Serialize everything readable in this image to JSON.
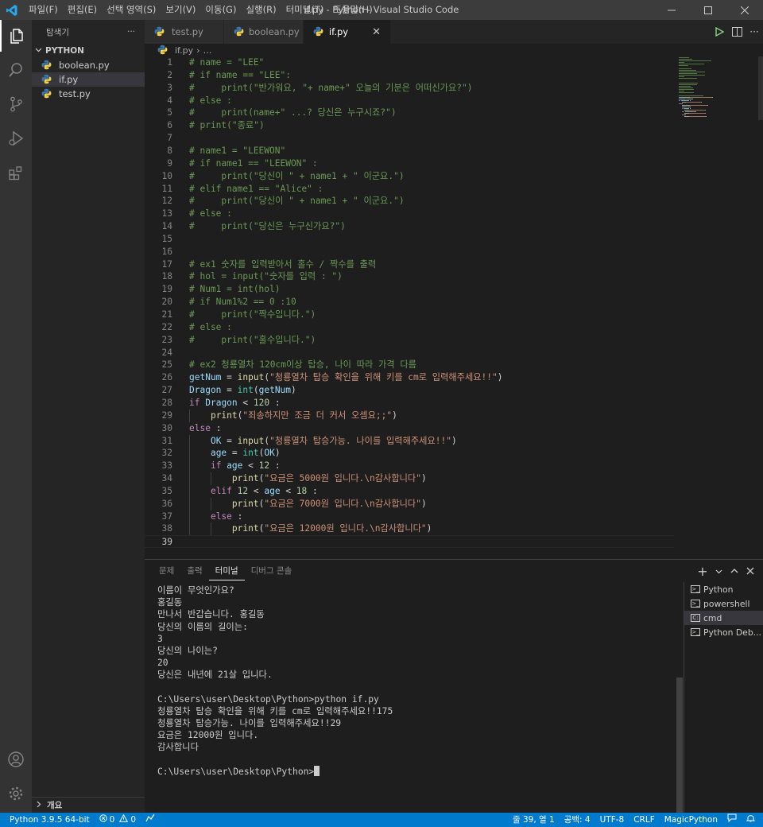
{
  "titlebar": {
    "menus": [
      "파일(F)",
      "편집(E)",
      "선택 영역(S)",
      "보기(V)",
      "이동(G)",
      "실행(R)",
      "터미널(T)",
      "도움말(H)"
    ],
    "window_title": "if.py - Python - Visual Studio Code"
  },
  "sidebar": {
    "title": "탐색기",
    "more": "···",
    "folder": "PYTHON",
    "files": [
      "boolean.py",
      "if.py",
      "test.py"
    ],
    "selected_file": "if.py",
    "outline": "개요"
  },
  "tabs": [
    {
      "label": "test.py",
      "active": false
    },
    {
      "label": "boolean.py",
      "active": false
    },
    {
      "label": "if.py",
      "active": true
    }
  ],
  "breadcrumb": {
    "file": "if.py",
    "rest": "…"
  },
  "editor": {
    "current_line": 39,
    "lines": [
      {
        "n": 1,
        "tokens": [
          [
            "cm",
            "# name = \"LEE\""
          ]
        ]
      },
      {
        "n": 2,
        "tokens": [
          [
            "cm",
            "# if name == \"LEE\":"
          ]
        ]
      },
      {
        "n": 3,
        "tokens": [
          [
            "cm",
            "#     print(\"반가워요, \"+ name+\" 오늘의 기분은 어떠신가요?\")"
          ]
        ]
      },
      {
        "n": 4,
        "tokens": [
          [
            "cm",
            "# else :"
          ]
        ]
      },
      {
        "n": 5,
        "tokens": [
          [
            "cm",
            "#     print(name+\" ...? 당신은 누구시죠?\")"
          ]
        ]
      },
      {
        "n": 6,
        "tokens": [
          [
            "cm",
            "# print(\"종료\")"
          ]
        ]
      },
      {
        "n": 7,
        "tokens": []
      },
      {
        "n": 8,
        "tokens": [
          [
            "cm",
            "# name1 = \"LEEWON\""
          ]
        ]
      },
      {
        "n": 9,
        "tokens": [
          [
            "cm",
            "# if name1 == \"LEEWON\" :"
          ]
        ]
      },
      {
        "n": 10,
        "tokens": [
          [
            "cm",
            "#     print(\"당신이 \" + name1 + \" 이군요.\")"
          ]
        ]
      },
      {
        "n": 11,
        "tokens": [
          [
            "cm",
            "# elif name1 == \"Alice\" :"
          ]
        ]
      },
      {
        "n": 12,
        "tokens": [
          [
            "cm",
            "#     print(\"당신이 \" + name1 + \" 이군요.\")"
          ]
        ]
      },
      {
        "n": 13,
        "tokens": [
          [
            "cm",
            "# else :"
          ]
        ]
      },
      {
        "n": 14,
        "tokens": [
          [
            "cm",
            "#     print(\"당신은 누구신가요?\")"
          ]
        ]
      },
      {
        "n": 15,
        "tokens": []
      },
      {
        "n": 16,
        "tokens": []
      },
      {
        "n": 17,
        "tokens": [
          [
            "cm",
            "# ex1 숫자를 입력받아서 홀수 / 짝수를 출력"
          ]
        ]
      },
      {
        "n": 18,
        "tokens": [
          [
            "cm",
            "# hol = input(\"숫자를 입력 : \")"
          ]
        ]
      },
      {
        "n": 19,
        "tokens": [
          [
            "cm",
            "# Num1 = int(hol)"
          ]
        ]
      },
      {
        "n": 20,
        "tokens": [
          [
            "cm",
            "# if Num1%2 == 0 :10"
          ]
        ]
      },
      {
        "n": 21,
        "tokens": [
          [
            "cm",
            "#     print(\"짝수입니다.\")"
          ]
        ]
      },
      {
        "n": 22,
        "tokens": [
          [
            "cm",
            "# else :"
          ]
        ]
      },
      {
        "n": 23,
        "tokens": [
          [
            "cm",
            "#     print(\"홀수입니다.\")"
          ]
        ]
      },
      {
        "n": 24,
        "tokens": []
      },
      {
        "n": 25,
        "tokens": [
          [
            "cm",
            "# ex2 청룡열차 120cm이상 탑승, 나이 따라 가격 다름"
          ]
        ]
      },
      {
        "n": 26,
        "tokens": [
          [
            "vr",
            "getNum"
          ],
          [
            "op",
            " = "
          ],
          [
            "fn",
            "input"
          ],
          [
            "op",
            "("
          ],
          [
            "st",
            "\"청룡열차 탑승 확인을 위해 키를 cm로 입력해주세요!!\""
          ],
          [
            "op",
            ")"
          ]
        ]
      },
      {
        "n": 27,
        "tokens": [
          [
            "vr",
            "Dragon"
          ],
          [
            "op",
            " = "
          ],
          [
            "bi",
            "int"
          ],
          [
            "op",
            "("
          ],
          [
            "vr",
            "getNum"
          ],
          [
            "op",
            ")"
          ]
        ]
      },
      {
        "n": 28,
        "tokens": [
          [
            "kw",
            "if"
          ],
          [
            "op",
            " "
          ],
          [
            "vr",
            "Dragon"
          ],
          [
            "op",
            " < "
          ],
          [
            "nm",
            "120"
          ],
          [
            "op",
            " :"
          ]
        ]
      },
      {
        "n": 29,
        "tokens": [
          [
            "op",
            "    "
          ],
          [
            "fn",
            "print"
          ],
          [
            "op",
            "("
          ],
          [
            "st",
            "\"죄송하지만 조금 더 커서 오셈요;;\""
          ],
          [
            "op",
            ")"
          ]
        ]
      },
      {
        "n": 30,
        "tokens": [
          [
            "kw",
            "else"
          ],
          [
            "op",
            " :"
          ]
        ]
      },
      {
        "n": 31,
        "tokens": [
          [
            "op",
            "    "
          ],
          [
            "vr",
            "OK"
          ],
          [
            "op",
            " = "
          ],
          [
            "fn",
            "input"
          ],
          [
            "op",
            "("
          ],
          [
            "st",
            "\"청룡열차 탑승가능. 나이를 입력해주세요!!\""
          ],
          [
            "op",
            ")"
          ]
        ]
      },
      {
        "n": 32,
        "tokens": [
          [
            "op",
            "    "
          ],
          [
            "vr",
            "age"
          ],
          [
            "op",
            " = "
          ],
          [
            "bi",
            "int"
          ],
          [
            "op",
            "("
          ],
          [
            "vr",
            "OK"
          ],
          [
            "op",
            ")"
          ]
        ]
      },
      {
        "n": 33,
        "tokens": [
          [
            "op",
            "    "
          ],
          [
            "kw",
            "if"
          ],
          [
            "op",
            " "
          ],
          [
            "vr",
            "age"
          ],
          [
            "op",
            " < "
          ],
          [
            "nm",
            "12"
          ],
          [
            "op",
            " :"
          ]
        ]
      },
      {
        "n": 34,
        "tokens": [
          [
            "op",
            "        "
          ],
          [
            "fn",
            "print"
          ],
          [
            "op",
            "("
          ],
          [
            "st",
            "\"요금은 5000원 입니다.\\n감사합니다\""
          ],
          [
            "op",
            ")"
          ]
        ]
      },
      {
        "n": 35,
        "tokens": [
          [
            "op",
            "    "
          ],
          [
            "kw",
            "elif"
          ],
          [
            "op",
            " "
          ],
          [
            "nm",
            "12"
          ],
          [
            "op",
            " < "
          ],
          [
            "vr",
            "age"
          ],
          [
            "op",
            " < "
          ],
          [
            "nm",
            "18"
          ],
          [
            "op",
            " :"
          ]
        ]
      },
      {
        "n": 36,
        "tokens": [
          [
            "op",
            "        "
          ],
          [
            "fn",
            "print"
          ],
          [
            "op",
            "("
          ],
          [
            "st",
            "\"요금은 7000원 입니다.\\n감사합니다\""
          ],
          [
            "op",
            ")"
          ]
        ]
      },
      {
        "n": 37,
        "tokens": [
          [
            "op",
            "    "
          ],
          [
            "kw",
            "else"
          ],
          [
            "op",
            " :"
          ]
        ]
      },
      {
        "n": 38,
        "tokens": [
          [
            "op",
            "        "
          ],
          [
            "fn",
            "print"
          ],
          [
            "op",
            "("
          ],
          [
            "st",
            "\"요금은 12000원 입니다.\\n감사합니다\""
          ],
          [
            "op",
            ")"
          ]
        ]
      },
      {
        "n": 39,
        "tokens": []
      }
    ]
  },
  "panel": {
    "tabs": [
      "문제",
      "출력",
      "터미널",
      "디버그 콘솔"
    ],
    "active_tab": "터미널",
    "add_label": "+",
    "terminal_lines": [
      "이름이 무엇인가요?",
      "홍길동",
      "만나서 반갑습니다. 홍길동",
      "당신의 이름의 길이는:",
      "3",
      "당신의 나이는?",
      "20",
      "당신은 내년에 21살 입니다.",
      "",
      "C:\\Users\\user\\Desktop\\Python>python if.py",
      "청룡열차 탑승 확인을 위해 키를 cm로 입력해주세요!!175",
      "청룡열차 탑승가능. 나이를 입력해주세요!!29",
      "요금은 12000원 입니다.",
      "감사합니다",
      ""
    ],
    "prompt": "C:\\Users\\user\\Desktop\\Python>",
    "terminals": [
      {
        "label": "Python",
        "selected": false
      },
      {
        "label": "powershell",
        "selected": false
      },
      {
        "label": "cmd",
        "selected": true
      },
      {
        "label": "Python Deb...",
        "selected": false
      }
    ]
  },
  "statusbar": {
    "interpreter": "Python 3.9.5 64-bit",
    "errors": "0",
    "warnings": "0",
    "position": "줄 39, 열 1",
    "spaces": "공백: 4",
    "encoding": "UTF-8",
    "eol": "CRLF",
    "language": "MagicPython"
  },
  "colors": {
    "accent": "#007acc",
    "comment": "#6a9955",
    "keyword": "#c586c0",
    "function": "#dcdcaa",
    "string": "#ce9178",
    "number": "#b5cea8",
    "variable": "#9cdcfe",
    "builtin": "#4ec9b0"
  }
}
